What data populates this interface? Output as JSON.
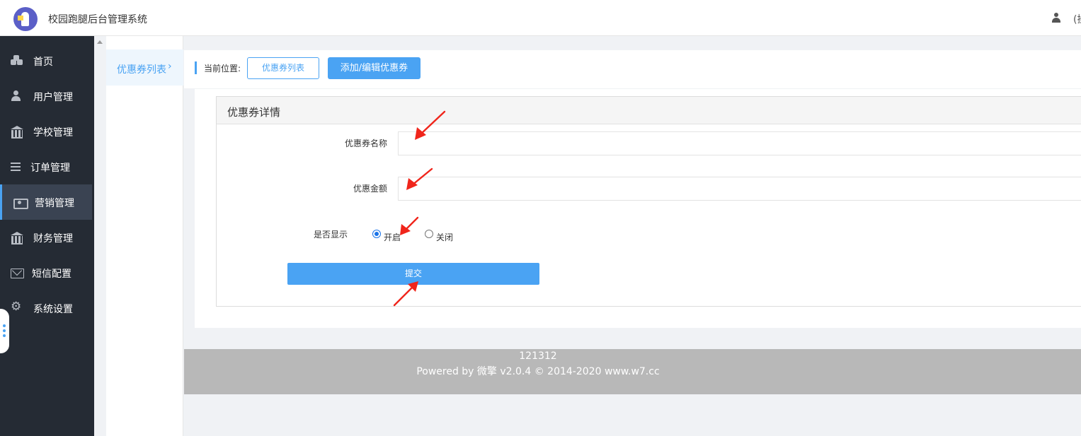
{
  "app": {
    "title": "校园跑腿后台管理系统",
    "user_name": "(操"
  },
  "sidebar": {
    "items": [
      {
        "label": "首页",
        "icon": "home-icon"
      },
      {
        "label": "用户管理",
        "icon": "user-icon"
      },
      {
        "label": "学校管理",
        "icon": "bank-icon"
      },
      {
        "label": "订单管理",
        "icon": "list-icon"
      },
      {
        "label": "营销管理",
        "icon": "money-icon",
        "active": true
      },
      {
        "label": "财务管理",
        "icon": "bank-icon"
      },
      {
        "label": "短信配置",
        "icon": "mail-icon"
      },
      {
        "label": "系统设置",
        "icon": "gear-icon"
      }
    ]
  },
  "subnav": {
    "items": [
      {
        "label": "优惠券列表",
        "chevron": "›"
      }
    ]
  },
  "breadcrumb": {
    "label": "当前位置:",
    "list_button": "优惠券列表",
    "edit_button": "添加/编辑优惠券"
  },
  "form": {
    "panel_title": "优惠券详情",
    "name_label": "优惠券名称",
    "name_value": "",
    "amount_label": "优惠金额",
    "amount_value": "",
    "display_label": "是否显示",
    "options": [
      "开启",
      "关闭"
    ],
    "selected": "开启",
    "submit_label": "提交"
  },
  "footer": {
    "line1": "121312",
    "line2": "Powered by 微擎 v2.0.4 © 2014-2020 www.w7.cc"
  },
  "colors": {
    "accent": "#4aa3f3",
    "sidebar_bg": "#252b34",
    "annotation_arrow": "#f0251b"
  }
}
